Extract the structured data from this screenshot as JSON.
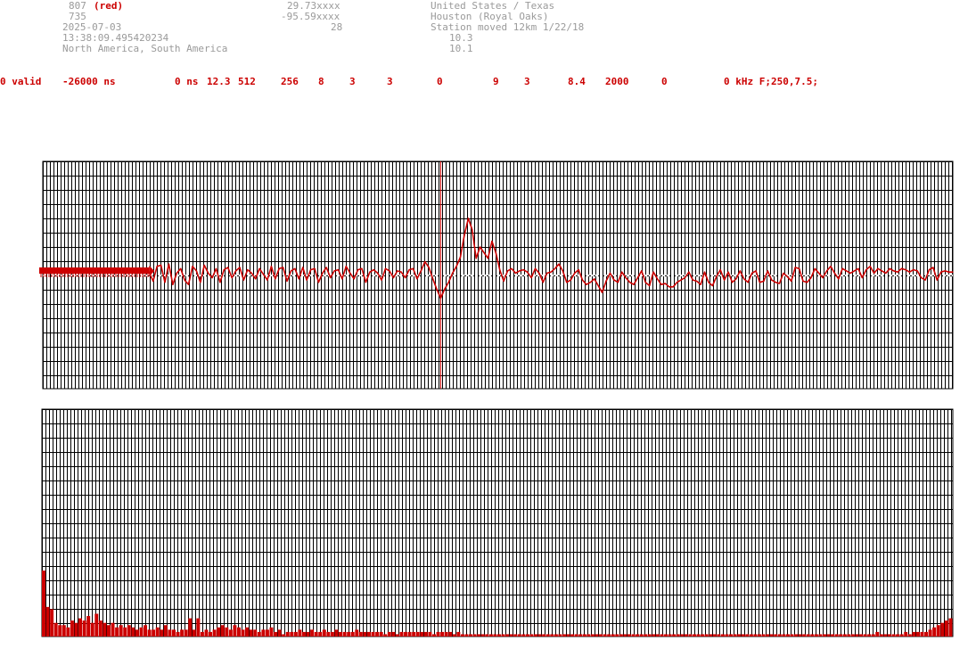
{
  "header": {
    "station_id": "807",
    "station_color_note": "(red)",
    "station_code": "735",
    "date": "2025-07-03",
    "time": "13:38:09.495420234",
    "region": "North America, South America",
    "latitude": "29.73xxxx",
    "longitude": "-95.59xxxx",
    "count": "28",
    "country": "United States / Texas",
    "location": "Houston (Royal Oaks)",
    "note": "Station moved 12km 1/22/18",
    "value_a": "10.3",
    "value_b": "10.1"
  },
  "status_line": {
    "valid": "0 valid",
    "offset": "-26000 ns",
    "f1": "0 ns",
    "f2": "12.3",
    "f3": "512",
    "f4": "256",
    "f5": "8",
    "f6": "3",
    "f7": "3",
    "f8": "0",
    "f9": "9",
    "f10": "3",
    "f11": "8.4",
    "f12": "2000",
    "f13": "0",
    "f14": "0 kHz F;250,7.5;"
  },
  "colors": {
    "signal": "#cc0000",
    "grid": "#000000",
    "header_text": "#9a9a9a"
  },
  "chart_data": [
    {
      "type": "line",
      "grid": true,
      "ylim": [
        -1,
        1
      ],
      "marker_index": 101,
      "x": [
        0,
        1,
        2,
        3,
        4,
        5,
        6,
        7,
        8,
        9,
        10,
        11,
        12,
        13,
        14,
        15,
        16,
        17,
        18,
        19,
        20,
        21,
        22,
        23,
        24,
        25,
        26,
        27,
        28,
        29,
        30,
        31,
        32,
        33,
        34,
        35,
        36,
        37,
        38,
        39,
        40,
        41,
        42,
        43,
        44,
        45,
        46,
        47,
        48,
        49,
        50,
        51,
        52,
        53,
        54,
        55,
        56,
        57,
        58,
        59,
        60,
        61,
        62,
        63,
        64,
        65,
        66,
        67,
        68,
        69,
        70,
        71,
        72,
        73,
        74,
        75,
        76,
        77,
        78,
        79,
        80,
        81,
        82,
        83,
        84,
        85,
        86,
        87,
        88,
        89,
        90,
        91,
        92,
        93,
        94,
        95,
        96,
        97,
        98,
        99,
        100,
        101,
        102,
        103,
        104,
        105,
        106,
        107,
        108,
        109,
        110,
        111,
        112,
        113,
        114,
        115,
        116,
        117,
        118,
        119,
        120,
        121,
        122,
        123,
        124,
        125,
        126,
        127,
        128,
        129,
        130,
        131,
        132,
        133,
        134,
        135,
        136,
        137,
        138,
        139,
        140,
        141,
        142,
        143,
        144,
        145,
        146,
        147,
        148,
        149,
        150,
        151,
        152,
        153,
        154,
        155,
        156,
        157,
        158,
        159,
        160,
        161,
        162,
        163,
        164,
        165,
        166,
        167,
        168,
        169,
        170,
        171,
        172,
        173,
        174,
        175,
        176,
        177,
        178,
        179,
        180,
        181,
        182,
        183,
        184,
        185,
        186,
        187,
        188,
        189,
        190,
        191,
        192,
        193,
        194,
        195,
        196,
        197,
        198,
        199,
        200,
        201,
        202,
        203,
        204,
        205,
        206,
        207,
        208,
        209,
        210,
        211,
        212,
        213,
        214,
        215,
        216,
        217,
        218,
        219,
        220,
        221,
        222,
        223,
        224,
        225,
        226,
        227,
        228,
        229,
        230
      ],
      "values": [
        0,
        0,
        0,
        0,
        0,
        0,
        0,
        0,
        0,
        0,
        0,
        0,
        0,
        0,
        0,
        0,
        0,
        0,
        0,
        0,
        0,
        0,
        0,
        0,
        0,
        0,
        0,
        0.03,
        -0.05,
        0.08,
        0.09,
        -0.06,
        0.1,
        -0.08,
        0.02,
        0.06,
        -0.04,
        -0.08,
        0.08,
        0.04,
        -0.06,
        0.09,
        0.02,
        -0.02,
        0.06,
        -0.06,
        0.05,
        0.07,
        -0.02,
        0.04,
        0.07,
        -0.04,
        0.05,
        0.02,
        -0.03,
        0.06,
        0.01,
        -0.04,
        0.08,
        -0.03,
        0.06,
        0.07,
        -0.05,
        0.04,
        0.06,
        -0.03,
        0.07,
        -0.04,
        0.05,
        0.06,
        -0.06,
        0.02,
        0.07,
        -0.02,
        0.04,
        0.05,
        -0.03,
        0.08,
        0.02,
        -0.03,
        0.05,
        0.06,
        -0.06,
        0.03,
        0.05,
        0.02,
        -0.04,
        0.06,
        0.04,
        -0.02,
        0.04,
        0.03,
        -0.02,
        0.05,
        0.06,
        -0.03,
        0.04,
        0.12,
        0.07,
        -0.03,
        -0.12,
        -0.2,
        -0.12,
        -0.06,
        0.02,
        0.08,
        0.16,
        0.35,
        0.5,
        0.4,
        0.15,
        0.25,
        0.2,
        0.15,
        0.3,
        0.2,
        0.05,
        -0.05,
        0.04,
        0.06,
        0.02,
        0.04,
        0.05,
        0.03,
        -0.02,
        0.06,
        0.02,
        -0.06,
        0.02,
        0.03,
        0.06,
        0.1,
        0.04,
        -0.06,
        -0.04,
        0.02,
        0.05,
        -0.04,
        -0.08,
        -0.06,
        -0.03,
        -0.09,
        -0.15,
        -0.05,
        0.02,
        -0.04,
        -0.06,
        0.03,
        -0.02,
        -0.06,
        -0.08,
        -0.02,
        0.04,
        -0.06,
        -0.09,
        0.03,
        -0.03,
        -0.08,
        -0.07,
        -0.1,
        -0.1,
        -0.06,
        -0.04,
        -0.02,
        0.03,
        -0.04,
        -0.05,
        -0.08,
        0.03,
        -0.06,
        -0.09,
        -0.01,
        0.05,
        -0.04,
        0.03,
        -0.06,
        -0.03,
        0.04,
        -0.03,
        -0.06,
        0.02,
        0.04,
        -0.06,
        -0.05,
        0.04,
        -0.04,
        -0.06,
        -0.07,
        0.02,
        -0.01,
        -0.05,
        0.07,
        0.06,
        -0.05,
        -0.06,
        -0.02,
        0.06,
        0.02,
        -0.02,
        0.04,
        0.08,
        0.02,
        -0.03,
        0.06,
        0.04,
        0.02,
        0.04,
        0.06,
        -0.02,
        0.05,
        0.08,
        0.02,
        0.06,
        0.04,
        0.02,
        0.06,
        0.04,
        0.03,
        0.06,
        0.05,
        0.03,
        0.05,
        0.04,
        -0.02,
        -0.04,
        0.05,
        0.07,
        -0.04,
        0.03,
        0.04,
        0.03,
        0.03
      ]
    },
    {
      "type": "bar",
      "grid": true,
      "ylim": [
        0,
        1
      ],
      "values": [
        0.29,
        0.13,
        0.12,
        0.06,
        0.05,
        0.05,
        0.04,
        0.07,
        0.06,
        0.08,
        0.07,
        0.09,
        0.06,
        0.1,
        0.07,
        0.06,
        0.05,
        0.06,
        0.04,
        0.05,
        0.04,
        0.05,
        0.04,
        0.03,
        0.04,
        0.05,
        0.03,
        0.03,
        0.04,
        0.03,
        0.05,
        0.03,
        0.03,
        0.02,
        0.03,
        0.03,
        0.08,
        0.03,
        0.08,
        0.02,
        0.03,
        0.02,
        0.03,
        0.04,
        0.05,
        0.04,
        0.03,
        0.05,
        0.04,
        0.03,
        0.04,
        0.03,
        0.03,
        0.02,
        0.03,
        0.03,
        0.04,
        0.02,
        0.03,
        0.01,
        0.02,
        0.02,
        0.02,
        0.03,
        0.02,
        0.02,
        0.03,
        0.02,
        0.02,
        0.03,
        0.02,
        0.02,
        0.03,
        0.02,
        0.02,
        0.02,
        0.02,
        0.03,
        0.02,
        0.02,
        0.02,
        0.02,
        0.02,
        0.02,
        0.01,
        0.02,
        0.02,
        0.01,
        0.02,
        0.02,
        0.02,
        0.02,
        0.02,
        0.02,
        0.02,
        0.02,
        0.01,
        0.02,
        0.02,
        0.02,
        0.02,
        0.01,
        0.02,
        0.01,
        0.01,
        0.01,
        0.01,
        0.01,
        0.01,
        0.01,
        0.01,
        0.01,
        0.01,
        0.01,
        0.01,
        0.01,
        0.01,
        0.01,
        0.01,
        0.01,
        0.01,
        0.01,
        0.01,
        0.01,
        0.01,
        0.01,
        0.01,
        0.01,
        0.01,
        0.01,
        0.01,
        0.01,
        0.01,
        0.01,
        0.01,
        0.01,
        0.01,
        0.01,
        0.01,
        0.01,
        0.01,
        0.01,
        0.01,
        0.01,
        0.01,
        0.01,
        0.01,
        0.01,
        0.01,
        0.01,
        0.01,
        0.01,
        0.01,
        0.01,
        0.01,
        0.01,
        0.01,
        0.01,
        0.01,
        0.01,
        0.01,
        0.01,
        0.01,
        0.01,
        0.01,
        0.01,
        0.01,
        0.01,
        0.01,
        0.01,
        0.01,
        0.01,
        0.01,
        0.01,
        0.01,
        0.01,
        0.01,
        0.01,
        0.01,
        0.01,
        0.01,
        0.01,
        0.01,
        0.01,
        0.01,
        0.01,
        0.01,
        0.01,
        0.01,
        0.01,
        0.01,
        0.01,
        0.01,
        0.01,
        0.01,
        0.01,
        0.01,
        0.01,
        0.01,
        0.01,
        0.01,
        0.01,
        0.01,
        0.01,
        0.01,
        0.02,
        0.01,
        0.01,
        0.01,
        0.01,
        0.01,
        0.01,
        0.02,
        0.01,
        0.02,
        0.02,
        0.02,
        0.02,
        0.03,
        0.04,
        0.05,
        0.06,
        0.07,
        0.08
      ]
    }
  ]
}
